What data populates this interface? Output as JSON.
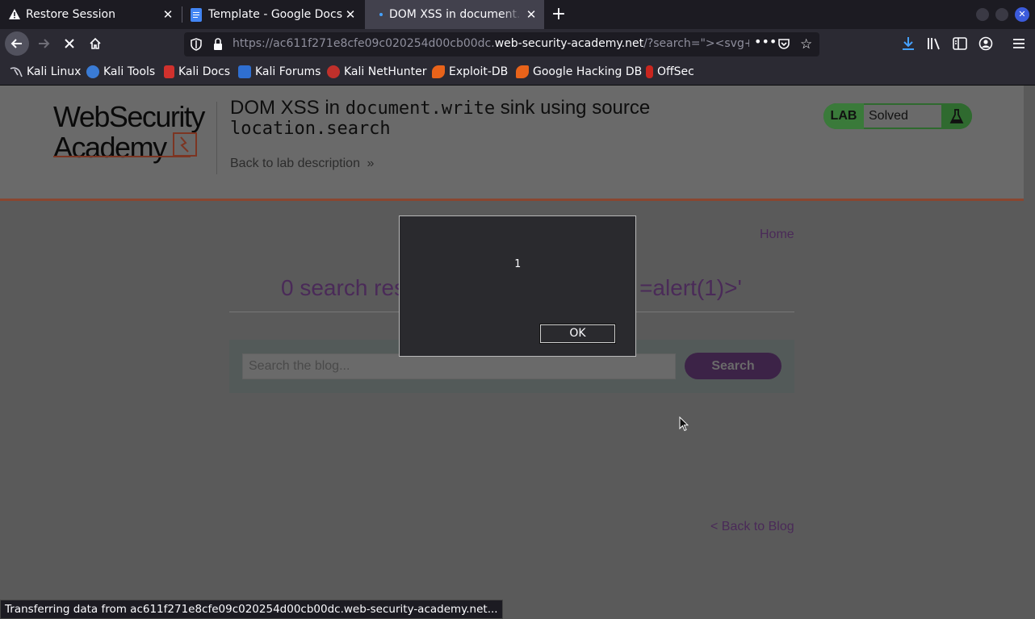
{
  "tabs": [
    {
      "title": "Restore Session",
      "icon": "warning-icon"
    },
    {
      "title": "Template - Google Docs",
      "icon": "google-docs-icon"
    },
    {
      "title": "DOM XSS in document.w",
      "icon": "loading-dot-icon"
    }
  ],
  "urlbar": {
    "prefix": "https://ac611f271e8cfe09c020254d00cb00dc.",
    "domain": "web-security-academy.net",
    "suffix": "/?search=\"><svg+o"
  },
  "bookmarks": [
    {
      "label": "Kali Linux",
      "icon": "kali-dragon-icon"
    },
    {
      "label": "Kali Tools",
      "icon": "kali-tools-icon"
    },
    {
      "label": "Kali Docs",
      "icon": "kali-docs-icon"
    },
    {
      "label": "Kali Forums",
      "icon": "kali-forums-icon"
    },
    {
      "label": "Kali NetHunter",
      "icon": "nethunter-icon"
    },
    {
      "label": "Exploit-DB",
      "icon": "exploit-db-icon"
    },
    {
      "label": "Google Hacking DB",
      "icon": "ghdb-icon"
    },
    {
      "label": "OffSec",
      "icon": "offsec-icon"
    }
  ],
  "page": {
    "logo_line1": "WebSecurity",
    "logo_line2": "Academy",
    "title_part1": "DOM XSS in ",
    "title_code1": "document.write",
    "title_part2": " sink using source",
    "title_code2": "location.search",
    "back_to_description": "Back to lab description",
    "lab_label": "LAB",
    "lab_status": "Solved",
    "home_link": "Home",
    "results_heading_left": "0 search res",
    "results_heading_right": "=alert(1)>'",
    "search_placeholder": "Search the blog...",
    "search_button": "Search",
    "back_to_blog": "< Back to Blog"
  },
  "dialog": {
    "message": "1",
    "ok_label": "OK"
  },
  "status_text": "Transferring data from ac611f271e8cfe09c020254d00cb00dc.web-security-academy.net...",
  "colors": {
    "accent_purple": "#4a2a58",
    "lab_green": "#3a7a3a",
    "header_rule": "#8a4630",
    "download_arrow": "#45a1ff",
    "close_window": "#3b5bdb"
  }
}
